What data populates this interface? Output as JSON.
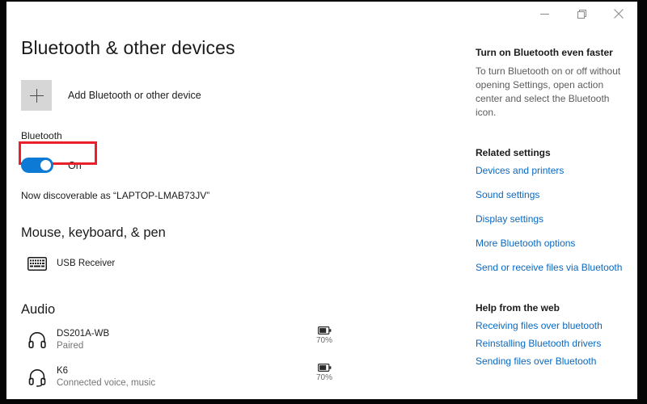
{
  "window": {
    "controls": {
      "minimize": "minimize-button",
      "maximize": "restore-button",
      "close": "close-button"
    }
  },
  "main": {
    "page_title": "Bluetooth & other devices",
    "add_device": {
      "label": "Add Bluetooth or other device",
      "icon": "plus-icon"
    },
    "bluetooth": {
      "label": "Bluetooth",
      "state": "On",
      "toggle_on": true,
      "highlight_color": "#e8212b",
      "accent_color": "#0d7ad6",
      "discoverable_text": "Now discoverable as “LAPTOP-LMAB73JV”"
    },
    "groups": [
      {
        "title": "Mouse, keyboard, & pen",
        "devices": [
          {
            "name": "USB Receiver",
            "status": "",
            "icon": "keyboard-icon",
            "battery": "",
            "has_battery": false
          }
        ]
      },
      {
        "title": "Audio",
        "devices": [
          {
            "name": "DS201A-WB",
            "status": "Paired",
            "icon": "headphones-icon",
            "battery": "70%",
            "has_battery": true
          },
          {
            "name": "K6",
            "status": "Connected voice, music",
            "icon": "headset-icon",
            "battery": "70%",
            "has_battery": true
          }
        ]
      }
    ]
  },
  "sidepanel": {
    "tip": {
      "heading": "Turn on Bluetooth even faster",
      "body": "To turn Bluetooth on or off without opening Settings, open action center and select the Bluetooth icon."
    },
    "related": {
      "heading": "Related settings",
      "links": [
        "Devices and printers",
        "Sound settings",
        "Display settings",
        "More Bluetooth options",
        "Send or receive files via Bluetooth"
      ]
    },
    "help": {
      "heading": "Help from the web",
      "links": [
        "Receiving files over bluetooth",
        "Reinstalling Bluetooth drivers",
        "Sending files over Bluetooth"
      ]
    }
  }
}
